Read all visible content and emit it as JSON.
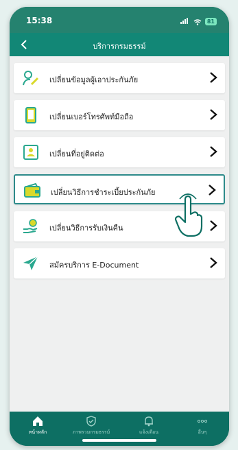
{
  "status_bar": {
    "time": "15:38",
    "battery": "81"
  },
  "header": {
    "title": "บริการกรมธรรม์"
  },
  "menu": [
    {
      "label": "เปลี่ยนข้อมูลผู้เอาประกันภัย",
      "icon": "person-edit-icon"
    },
    {
      "label": "เปลี่ยนเบอร์โทรศัพท์มือถือ",
      "icon": "mobile-phone-icon"
    },
    {
      "label": "เปลี่ยนที่อยู่ติดต่อ",
      "icon": "address-card-icon"
    },
    {
      "label": "เปลี่ยนวิธีการชำระเบี้ยประกันภัย",
      "icon": "wallet-icon",
      "selected": true
    },
    {
      "label": "เปลี่ยนวิธีการรับเงินคืน",
      "icon": "money-hand-icon"
    },
    {
      "label": "สมัครบริการ E-Document",
      "icon": "paper-plane-icon"
    }
  ],
  "tabs": [
    {
      "label": "หน้าหลัก",
      "icon": "home-icon",
      "active": true
    },
    {
      "label": "ภาพรวมกรมธรรม์",
      "icon": "shield-icon"
    },
    {
      "label": "แจ้งเตือน",
      "icon": "bell-icon"
    },
    {
      "label": "อื่นๆ",
      "icon": "more-icon"
    }
  ],
  "colors": {
    "primary": "#0d6f63",
    "accent": "#2aa88f",
    "icon_yellow": "#d9d92a"
  }
}
